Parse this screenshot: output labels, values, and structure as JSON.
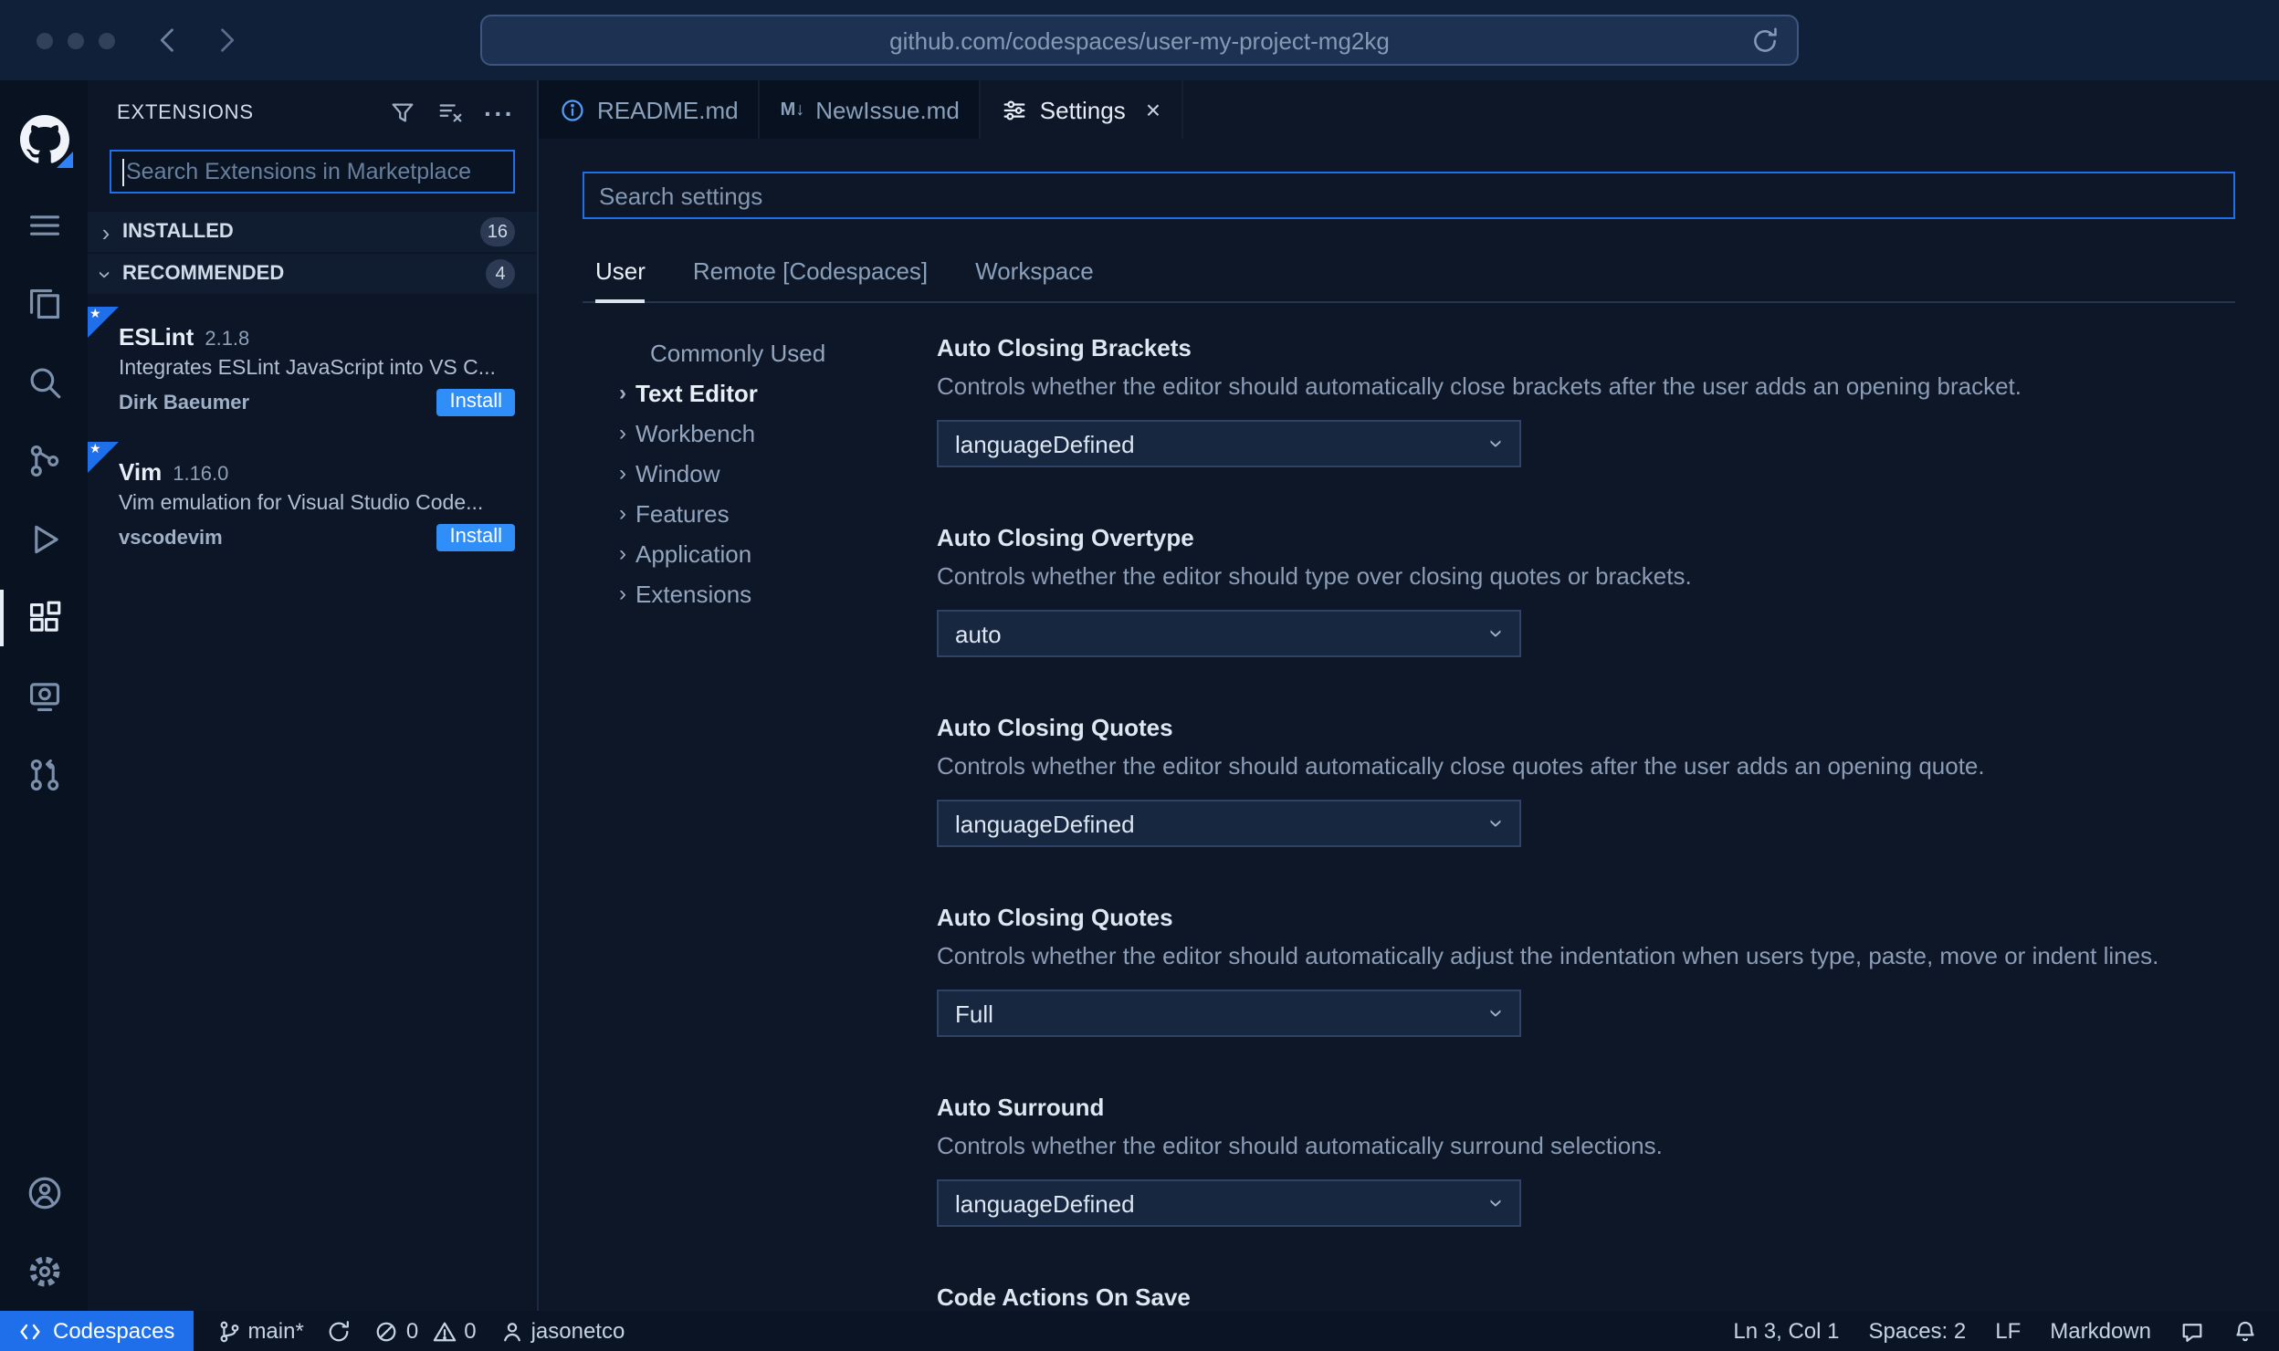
{
  "browser": {
    "url": "github.com/codespaces/user-my-project-mg2kg"
  },
  "colors": {
    "accent": "#1f6feb",
    "install_button": "#2f8ef7",
    "statusbar_remote": "#1f6feb",
    "focus_border": "#1f6feb"
  },
  "activity_bar": {
    "icons": [
      "github-codespaces-logo",
      "menu",
      "explorer",
      "search",
      "source-control",
      "run-debug",
      "extensions",
      "remote-explorer",
      "pull-requests",
      "account",
      "settings-gear"
    ],
    "active": "extensions"
  },
  "sidebar": {
    "title": "EXTENSIONS",
    "search": {
      "placeholder": "Search Extensions in Marketplace"
    },
    "sections": [
      {
        "label": "INSTALLED",
        "badge": "16",
        "expanded": false
      },
      {
        "label": "RECOMMENDED",
        "badge": "4",
        "expanded": true
      }
    ],
    "extensions": [
      {
        "name": "ESLint",
        "version": "2.1.8",
        "description": "Integrates ESLint JavaScript into VS C...",
        "author": "Dirk Baeumer",
        "action": "Install"
      },
      {
        "name": "Vim",
        "version": "1.16.0",
        "description": "Vim emulation for Visual Studio Code...",
        "author": "vscodevim",
        "action": "Install"
      }
    ]
  },
  "editor": {
    "tabs": [
      "README.md",
      "NewIssue.md",
      "Settings"
    ],
    "active_tab": "Settings"
  },
  "settings": {
    "search": {
      "placeholder": "Search settings"
    },
    "scopes": [
      "User",
      "Remote [Codespaces]",
      "Workspace"
    ],
    "active_scope": "User",
    "toc": [
      "Commonly Used",
      "Text Editor",
      "Workbench",
      "Window",
      "Features",
      "Application",
      "Extensions"
    ],
    "active_toc": "Text Editor",
    "items": [
      {
        "title": "Auto Closing Brackets",
        "description": "Controls whether the editor should automatically close brackets after the user adds an opening bracket.",
        "value": "languageDefined"
      },
      {
        "title": "Auto Closing Overtype",
        "description": "Controls whether the editor should type over closing quotes or brackets.",
        "value": "auto"
      },
      {
        "title": "Auto Closing Quotes",
        "description": "Controls whether the editor should automatically close quotes after the user adds an opening quote.",
        "value": "languageDefined"
      },
      {
        "title": "Auto Closing Quotes",
        "description": "Controls whether the editor should automatically adjust the indentation when users type, paste, move or indent lines.",
        "value": "Full"
      },
      {
        "title": "Auto Surround",
        "description": "Controls whether the editor should automatically surround selections.",
        "value": "languageDefined"
      },
      {
        "title": "Code Actions On Save"
      }
    ]
  },
  "status_bar": {
    "remote": "Codespaces",
    "branch": "main*",
    "errors": "0",
    "warnings": "0",
    "user": "jasonetco",
    "line_col": "Ln 3, Col 1",
    "indent": "Spaces: 2",
    "eol": "LF",
    "language": "Markdown"
  }
}
